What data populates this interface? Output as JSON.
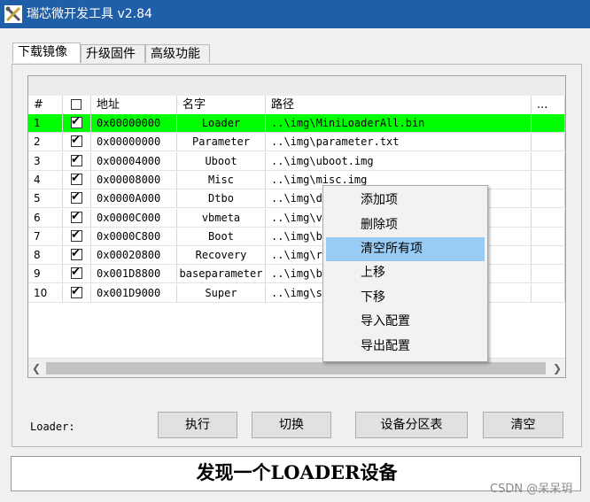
{
  "window": {
    "title": "瑞芯微开发工具 v2.84"
  },
  "tabs": [
    {
      "label": "下载镜像",
      "active": true
    },
    {
      "label": "升级固件",
      "active": false
    },
    {
      "label": "高级功能",
      "active": false
    }
  ],
  "table": {
    "columns": {
      "num": "#",
      "addr": "地址",
      "name": "名字",
      "path": "路径",
      "more": "..."
    },
    "rows": [
      {
        "num": "1",
        "checked": true,
        "addr": "0x00000000",
        "name": "Loader",
        "path": "..\\img\\MiniLoaderAll.bin",
        "selected": true
      },
      {
        "num": "2",
        "checked": true,
        "addr": "0x00000000",
        "name": "Parameter",
        "path": "..\\img\\parameter.txt"
      },
      {
        "num": "3",
        "checked": true,
        "addr": "0x00004000",
        "name": "Uboot",
        "path": "..\\img\\uboot.img"
      },
      {
        "num": "4",
        "checked": true,
        "addr": "0x00008000",
        "name": "Misc",
        "path": "..\\img\\misc.img"
      },
      {
        "num": "5",
        "checked": true,
        "addr": "0x0000A000",
        "name": "Dtbo",
        "path": "..\\img\\d"
      },
      {
        "num": "6",
        "checked": true,
        "addr": "0x0000C000",
        "name": "vbmeta",
        "path": "..\\img\\v"
      },
      {
        "num": "7",
        "checked": true,
        "addr": "0x0000C800",
        "name": "Boot",
        "path": "..\\img\\b"
      },
      {
        "num": "8",
        "checked": true,
        "addr": "0x00020800",
        "name": "Recovery",
        "path": "..\\img\\r"
      },
      {
        "num": "9",
        "checked": true,
        "addr": "0x001D8800",
        "name": "baseparameter",
        "path": "..\\img\\b"
      },
      {
        "num": "10",
        "checked": true,
        "addr": "0x001D9000",
        "name": "Super",
        "path": "..\\img\\s"
      }
    ]
  },
  "context_menu": {
    "items": [
      {
        "label": "添加项"
      },
      {
        "label": "删除项"
      },
      {
        "label": "清空所有项",
        "highlighted": true
      },
      {
        "label": "上移"
      },
      {
        "label": "下移"
      },
      {
        "label": "导入配置"
      },
      {
        "label": "导出配置"
      }
    ]
  },
  "loader_label": "Loader:",
  "buttons": {
    "execute": "执行",
    "switch": "切换",
    "partition": "设备分区表",
    "clear": "清空"
  },
  "status_text": "发现一个LOADER设备",
  "watermark": "CSDN @呆呆玥",
  "colors": {
    "titlebar": "#1f5fa8",
    "selected_row": "#00ff00",
    "menu_highlight": "#99ccf4"
  },
  "icons": {
    "app": "tools-icon",
    "scroll_left": "chevron-left-icon",
    "scroll_right": "chevron-right-icon"
  }
}
